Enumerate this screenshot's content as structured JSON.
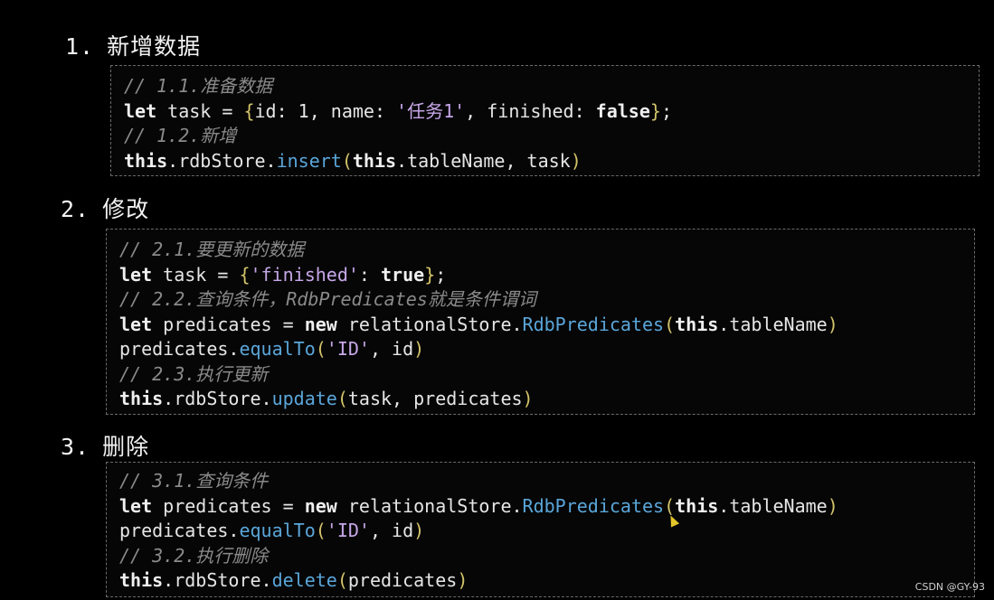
{
  "sections": [
    {
      "number": "1.",
      "title": "新增数据",
      "lines": [
        {
          "comment": "// 1.1.准备数据"
        },
        {
          "parts": [
            {
              "k": "kw",
              "t": "let"
            },
            {
              "k": "nm",
              "t": " task = "
            },
            {
              "k": "br",
              "t": "{"
            },
            {
              "k": "nm",
              "t": "id: 1, name: "
            },
            {
              "k": "st",
              "t": "'任务1'"
            },
            {
              "k": "nm",
              "t": ", finished: "
            },
            {
              "k": "kw",
              "t": "false"
            },
            {
              "k": "br",
              "t": "}"
            },
            {
              "k": "nm",
              "t": ";"
            }
          ]
        },
        {
          "comment": "// 1.2.新增"
        },
        {
          "parts": [
            {
              "k": "kw",
              "t": "this"
            },
            {
              "k": "nm",
              "t": ".rdbStore."
            },
            {
              "k": "fn",
              "t": "insert"
            },
            {
              "k": "br",
              "t": "("
            },
            {
              "k": "kw",
              "t": "this"
            },
            {
              "k": "nm",
              "t": ".tableName, task"
            },
            {
              "k": "br",
              "t": ")"
            }
          ]
        }
      ]
    },
    {
      "number": "2.",
      "title": "修改",
      "lines": [
        {
          "comment": "// 2.1.要更新的数据"
        },
        {
          "parts": [
            {
              "k": "kw",
              "t": "let"
            },
            {
              "k": "nm",
              "t": " task = "
            },
            {
              "k": "br",
              "t": "{"
            },
            {
              "k": "st",
              "t": "'finished'"
            },
            {
              "k": "nm",
              "t": ": "
            },
            {
              "k": "kw",
              "t": "true"
            },
            {
              "k": "br",
              "t": "}"
            },
            {
              "k": "nm",
              "t": ";"
            }
          ]
        },
        {
          "comment": "// 2.2.查询条件，RdbPredicates就是条件谓词"
        },
        {
          "parts": [
            {
              "k": "kw",
              "t": "let"
            },
            {
              "k": "nm",
              "t": " predicates = "
            },
            {
              "k": "kw",
              "t": "new"
            },
            {
              "k": "nm",
              "t": " relationalStore."
            },
            {
              "k": "fn",
              "t": "RdbPredicates"
            },
            {
              "k": "br",
              "t": "("
            },
            {
              "k": "kw",
              "t": "this"
            },
            {
              "k": "nm",
              "t": ".tableName"
            },
            {
              "k": "br",
              "t": ")"
            }
          ]
        },
        {
          "parts": [
            {
              "k": "nm",
              "t": "predicates."
            },
            {
              "k": "fn",
              "t": "equalTo"
            },
            {
              "k": "br",
              "t": "("
            },
            {
              "k": "st",
              "t": "'ID'"
            },
            {
              "k": "nm",
              "t": ", id"
            },
            {
              "k": "br",
              "t": ")"
            }
          ]
        },
        {
          "comment": "// 2.3.执行更新"
        },
        {
          "parts": [
            {
              "k": "kw",
              "t": "this"
            },
            {
              "k": "nm",
              "t": ".rdbStore."
            },
            {
              "k": "fn",
              "t": "update"
            },
            {
              "k": "br",
              "t": "("
            },
            {
              "k": "nm",
              "t": "task, predicates"
            },
            {
              "k": "br",
              "t": ")"
            }
          ]
        }
      ]
    },
    {
      "number": "3.",
      "title": "删除",
      "lines": [
        {
          "comment": "// 3.1.查询条件"
        },
        {
          "parts": [
            {
              "k": "kw",
              "t": "let"
            },
            {
              "k": "nm",
              "t": " predicates = "
            },
            {
              "k": "kw",
              "t": "new"
            },
            {
              "k": "nm",
              "t": " relationalStore."
            },
            {
              "k": "fn",
              "t": "RdbPredicates"
            },
            {
              "k": "br",
              "t": "("
            },
            {
              "k": "kw",
              "t": "this"
            },
            {
              "k": "nm",
              "t": ".tableName"
            },
            {
              "k": "br",
              "t": ")"
            }
          ]
        },
        {
          "parts": [
            {
              "k": "nm",
              "t": "predicates."
            },
            {
              "k": "fn",
              "t": "equalTo"
            },
            {
              "k": "br",
              "t": "("
            },
            {
              "k": "st",
              "t": "'ID'"
            },
            {
              "k": "nm",
              "t": ", id"
            },
            {
              "k": "br",
              "t": ")"
            }
          ]
        },
        {
          "comment": "// 3.2.执行删除"
        },
        {
          "parts": [
            {
              "k": "kw",
              "t": "this"
            },
            {
              "k": "nm",
              "t": ".rdbStore."
            },
            {
              "k": "fn",
              "t": "delete"
            },
            {
              "k": "br",
              "t": "("
            },
            {
              "k": "nm",
              "t": "predicates"
            },
            {
              "k": "br",
              "t": ")"
            }
          ]
        }
      ]
    }
  ],
  "watermark": "CSDN @GY-93",
  "colors": {
    "background": "#000000",
    "keyword": "#f0f0f0",
    "function": "#5aa6d9",
    "string": "#c6a7e8",
    "comment": "#8a8a8a",
    "bracket": "#d4c46a"
  }
}
